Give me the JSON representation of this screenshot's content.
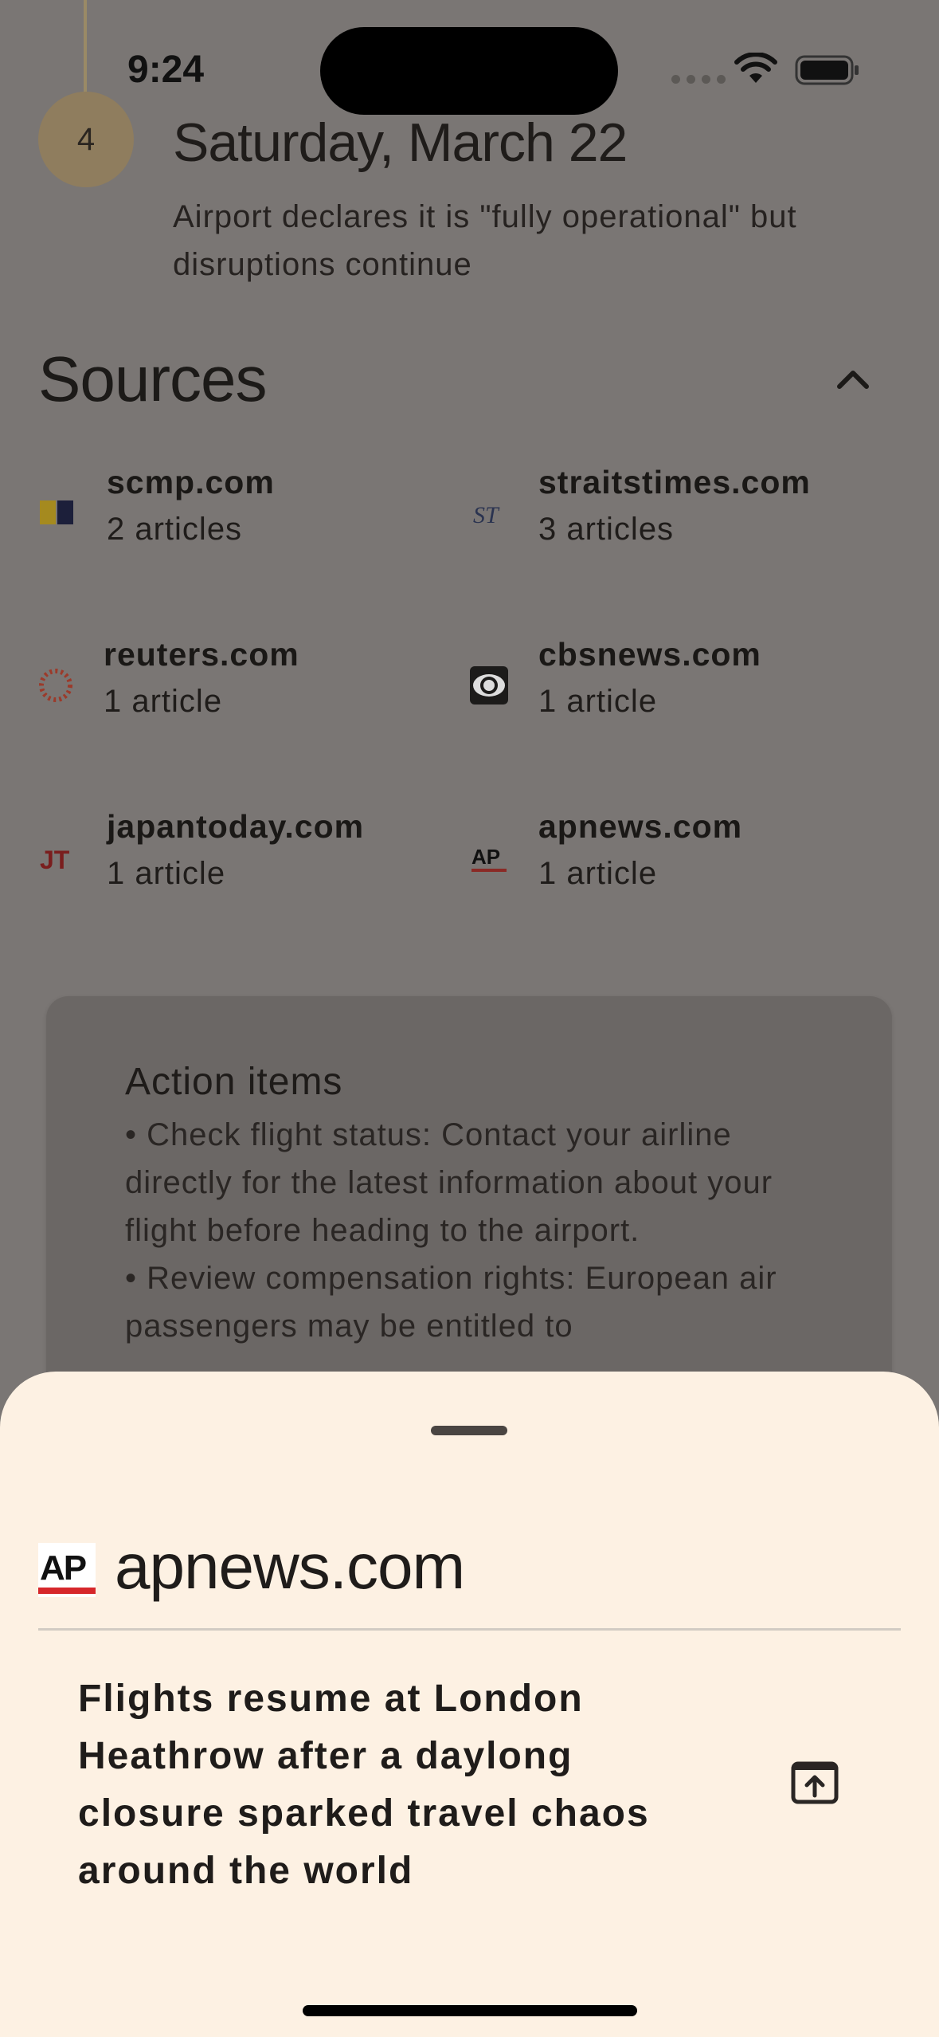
{
  "status_bar": {
    "time": "9:24"
  },
  "timeline": {
    "step": "4",
    "date": "Saturday, March 22",
    "description": "Airport declares it is \"fully operational\" but disruptions continue"
  },
  "sources": {
    "title": "Sources",
    "items": [
      {
        "name": "scmp.com",
        "count": "2 articles",
        "icon": "scmp-logo-icon"
      },
      {
        "name": "straitstimes.com",
        "count": "3 articles",
        "icon": "straitstimes-logo-icon",
        "logo_text": "ST"
      },
      {
        "name": "reuters.com",
        "count": "1 article",
        "icon": "reuters-logo-icon"
      },
      {
        "name": "cbsnews.com",
        "count": "1 article",
        "icon": "cbs-eye-logo-icon"
      },
      {
        "name": "japantoday.com",
        "count": "1 article",
        "icon": "japantoday-logo-icon",
        "logo_text": "JT"
      },
      {
        "name": "apnews.com",
        "count": "1 article",
        "icon": "ap-logo-icon",
        "logo_text": "AP"
      }
    ]
  },
  "action_items": {
    "title": "Action items",
    "lines": [
      "• Check flight status: Contact your airline directly for the latest information about your flight before heading to the airport.",
      "• Review compensation rights: European air passengers may be entitled to"
    ]
  },
  "sheet": {
    "domain": "apnews.com",
    "logo_text": "AP",
    "headline": "Flights resume at London Heathrow after a daylong closure sparked travel chaos around the world",
    "open_icon": "open-external-icon"
  },
  "colors": {
    "overlay_bg": "#7a7674",
    "sheet_bg": "#fdf1e3",
    "timeline_accent": "#8f7d5e",
    "ap_red": "#d6272b"
  }
}
